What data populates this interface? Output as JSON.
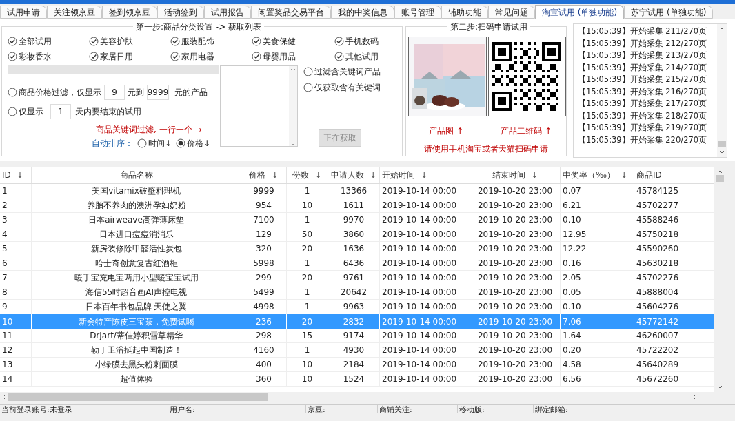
{
  "tabs": [
    {
      "label": "试用申请",
      "selected": false
    },
    {
      "label": "关注领京豆",
      "selected": false
    },
    {
      "label": "签到领京豆",
      "selected": false
    },
    {
      "label": "活动签到",
      "selected": false
    },
    {
      "label": "试用报告",
      "selected": false
    },
    {
      "label": "闲置奖品交易平台",
      "selected": false
    },
    {
      "label": "我的中奖信息",
      "selected": false
    },
    {
      "label": "账号管理",
      "selected": false
    },
    {
      "label": "辅助功能",
      "selected": false
    },
    {
      "label": "常见问题",
      "selected": false
    },
    {
      "label": "淘宝试用 (单独功能)",
      "selected": true
    },
    {
      "label": "苏宁试用 (单独功能)",
      "selected": false
    }
  ],
  "step1": {
    "title": "第一步:商品分类设置 -> 获取列表",
    "categories": [
      {
        "label": "全部试用",
        "checked": true
      },
      {
        "label": "美容护肤",
        "checked": true
      },
      {
        "label": "服装配饰",
        "checked": true
      },
      {
        "label": "美食保健",
        "checked": true
      },
      {
        "label": "手机数码",
        "checked": true
      },
      {
        "label": "彩妆香水",
        "checked": true
      },
      {
        "label": "家居日用",
        "checked": true
      },
      {
        "label": "家用电器",
        "checked": true
      },
      {
        "label": "母婴用品",
        "checked": true
      },
      {
        "label": "其他试用",
        "checked": true
      }
    ],
    "divider": "-------------------------------------------------------------",
    "price_filter": {
      "selected": false,
      "label": "商品价格过滤，仅显示",
      "min": "9",
      "to_label": "元到",
      "max": "9999",
      "suffix": "元的产品"
    },
    "days_filter": {
      "selected": false,
      "label": "仅显示",
      "value": "1",
      "suffix": "天内要结束的试用"
    },
    "keyword_hint": "商品关键词过滤, 一行一个 →",
    "keyword_options": [
      {
        "label": "过滤含关键词产品",
        "selected": false
      },
      {
        "label": "仅获取含有关键词",
        "selected": false
      }
    ],
    "sort": {
      "label": "自动排序：",
      "options": [
        {
          "label": "时间↓",
          "selected": false
        },
        {
          "label": "价格↓",
          "selected": true
        }
      ]
    },
    "fetch_button": {
      "label": "正在获取",
      "disabled": true
    }
  },
  "step2": {
    "title": "第二步:扫码申请试用",
    "image_caption": "产品图 ↑",
    "qr_caption": "产品二维码 ↑",
    "instruction": "请使用手机淘宝或者天猫扫码申请"
  },
  "log": [
    "【15:05:39】开始采集 211/270页",
    "【15:05:39】开始采集 212/270页",
    "【15:05:39】开始采集 213/270页",
    "【15:05:39】开始采集 214/270页",
    "【15:05:39】开始采集 215/270页",
    "【15:05:39】开始采集 216/270页",
    "【15:05:39】开始采集 217/270页",
    "【15:05:39】开始采集 218/270页",
    "【15:05:39】开始采集 219/270页",
    "【15:05:39】开始采集 220/270页"
  ],
  "table": {
    "columns": [
      {
        "label": "ID",
        "arrow": "↓"
      },
      {
        "label": "商品名称"
      },
      {
        "label": "价格",
        "arrow": "↓"
      },
      {
        "label": "份数",
        "arrow": "↓"
      },
      {
        "label": "申请人数",
        "arrow": "↓"
      },
      {
        "label": "开始时间",
        "arrow": "↓"
      },
      {
        "label": "结束时间",
        "arrow": "↓"
      },
      {
        "label": "中奖率（‰）",
        "arrow": "↓"
      },
      {
        "label": "商品ID"
      }
    ],
    "rows": [
      {
        "selected": false,
        "cells": [
          "1",
          "美国vitamix破壁料理机",
          "9999",
          "1",
          "13366",
          "2019-10-14 00:00",
          "2019-10-20 23:00",
          "0.07",
          "45784125"
        ]
      },
      {
        "selected": false,
        "cells": [
          "2",
          "养胎不养肉的澳洲孕妇奶粉",
          "954",
          "10",
          "1611",
          "2019-10-14 00:00",
          "2019-10-20 23:00",
          "6.21",
          "45702277"
        ]
      },
      {
        "selected": false,
        "cells": [
          "3",
          "日本airweave高弹薄床垫",
          "7100",
          "1",
          "9970",
          "2019-10-14 00:00",
          "2019-10-20 23:00",
          "0.10",
          "45588246"
        ]
      },
      {
        "selected": false,
        "cells": [
          "4",
          "日本进口痘痘消消乐",
          "129",
          "50",
          "3860",
          "2019-10-14 00:00",
          "2019-10-20 23:00",
          "12.95",
          "45750218"
        ]
      },
      {
        "selected": false,
        "cells": [
          "5",
          "新房装修除甲醛活性炭包",
          "320",
          "20",
          "1636",
          "2019-10-14 00:00",
          "2019-10-20 23:00",
          "12.22",
          "45590260"
        ]
      },
      {
        "selected": false,
        "cells": [
          "6",
          "哈士奇创意复古红酒柜",
          "5998",
          "1",
          "6436",
          "2019-10-14 00:00",
          "2019-10-20 23:00",
          "0.16",
          "45630218"
        ]
      },
      {
        "selected": false,
        "cells": [
          "7",
          "暖手宝充电宝两用小型暖宝宝试用",
          "299",
          "20",
          "9761",
          "2019-10-14 00:00",
          "2019-10-20 23:00",
          "2.05",
          "45702276"
        ]
      },
      {
        "selected": false,
        "cells": [
          "8",
          "海信55吋超音画AI声控电视",
          "5499",
          "1",
          "20642",
          "2019-10-14 00:00",
          "2019-10-20 23:00",
          "0.05",
          "45888004"
        ]
      },
      {
        "selected": false,
        "cells": [
          "9",
          "日本百年书包品牌 天使之翼",
          "4998",
          "1",
          "9963",
          "2019-10-14 00:00",
          "2019-10-20 23:00",
          "0.10",
          "45604276"
        ]
      },
      {
        "selected": true,
        "cells": [
          "10",
          "新会特产陈皮三宝茶，免费试喝",
          "236",
          "20",
          "2832",
          "2019-10-14 00:00",
          "2019-10-20 23:00",
          "7.06",
          "45772142"
        ]
      },
      {
        "selected": false,
        "cells": [
          "11",
          "DrJart/蒂佳婷积雪草精华",
          "298",
          "15",
          "9174",
          "2019-10-14 00:00",
          "2019-10-20 23:00",
          "1.64",
          "46260007"
        ]
      },
      {
        "selected": false,
        "cells": [
          "12",
          "勒丁卫浴挺起中国制造！",
          "4160",
          "1",
          "4930",
          "2019-10-14 00:00",
          "2019-10-20 23:00",
          "0.20",
          "45722202"
        ]
      },
      {
        "selected": false,
        "cells": [
          "13",
          "小绿膜去黑头粉刺面膜",
          "400",
          "10",
          "2184",
          "2019-10-14 00:00",
          "2019-10-20 23:00",
          "4.58",
          "45640289"
        ]
      },
      {
        "selected": false,
        "cells": [
          "14",
          "超值体验",
          "360",
          "10",
          "1524",
          "2019-10-14 00:00",
          "2019-10-20 23:00",
          "6.56",
          "45672260"
        ]
      }
    ]
  },
  "status_bar": [
    "当前登录账号:未登录",
    "用户名:",
    "京豆:",
    "商铺关注:",
    "移动版:",
    "绑定邮箱:"
  ]
}
